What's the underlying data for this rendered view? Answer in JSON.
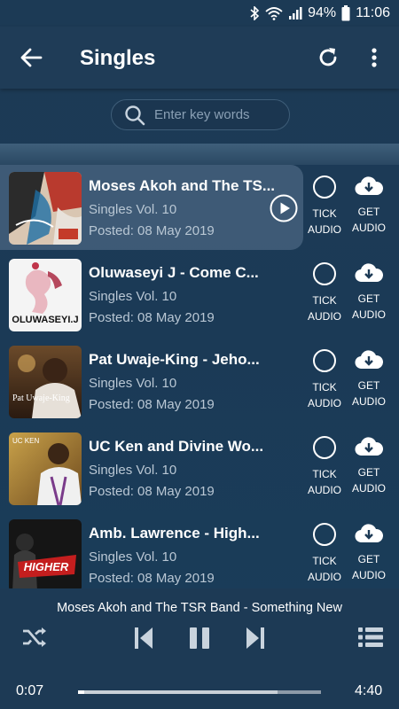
{
  "status_bar": {
    "battery": "94%",
    "time": "11:06"
  },
  "header": {
    "title": "Singles"
  },
  "search": {
    "placeholder": "Enter key words"
  },
  "songs": [
    {
      "title": "Moses Akoh and The TS...",
      "subtitle": "Singles Vol. 10",
      "posted": "Posted: 08 May 2019",
      "tick_label_1": "TICK",
      "tick_label_2": "AUDIO",
      "get_label_1": "GET",
      "get_label_2": "AUDIO",
      "playing": true
    },
    {
      "title": "Oluwaseyi J - Come C...",
      "subtitle": "Singles Vol. 10",
      "posted": "Posted: 08 May 2019",
      "tick_label_1": "TICK",
      "tick_label_2": "AUDIO",
      "get_label_1": "GET",
      "get_label_2": "AUDIO",
      "cover_text": "OLUWASEYI.J"
    },
    {
      "title": "Pat Uwaje-King - Jeho...",
      "subtitle": "Singles Vol. 10",
      "posted": "Posted: 08 May 2019",
      "tick_label_1": "TICK",
      "tick_label_2": "AUDIO",
      "get_label_1": "GET",
      "get_label_2": "AUDIO",
      "cover_text": "Pat Uwaje-King"
    },
    {
      "title": "UC Ken and Divine Wo...",
      "subtitle": "Singles Vol. 10",
      "posted": "Posted: 08 May 2019",
      "tick_label_1": "TICK",
      "tick_label_2": "AUDIO",
      "get_label_1": "GET",
      "get_label_2": "AUDIO",
      "cover_text": "UC KEN"
    },
    {
      "title": "Amb. Lawrence - High...",
      "subtitle": "Singles Vol. 10",
      "posted": "Posted: 08 May 2019",
      "tick_label_1": "TICK",
      "tick_label_2": "AUDIO",
      "get_label_1": "GET",
      "get_label_2": "AUDIO",
      "cover_text": "HIGHER"
    }
  ],
  "player": {
    "now_playing": "Moses Akoh and The TSR Band - Something New",
    "elapsed": "0:07",
    "duration": "4:40",
    "progress": 0.025
  },
  "colors": {
    "background": "#1d3a55",
    "accent": "#ffffff"
  }
}
